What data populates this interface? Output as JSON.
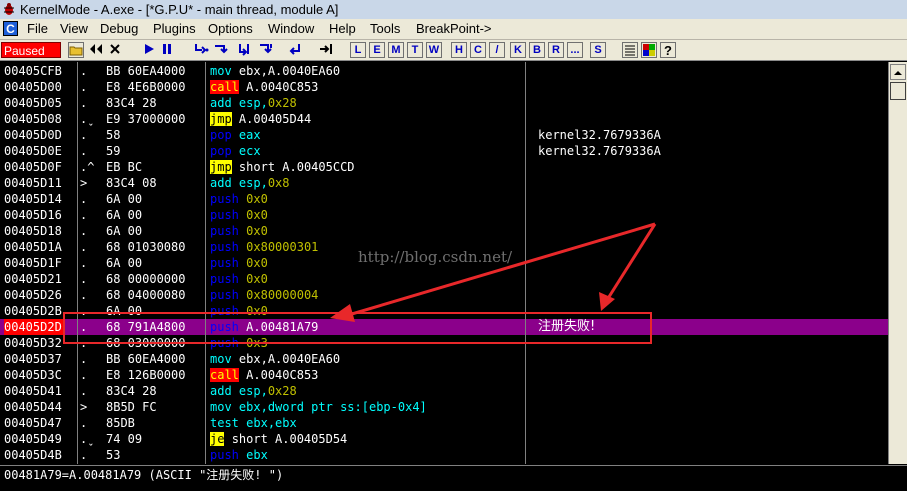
{
  "window": {
    "title": "KernelMode - A.exe - [*G.P.U* - main thread, module A]"
  },
  "menubar": {
    "system_label": "C",
    "items": [
      "File",
      "View",
      "Debug",
      "Plugins",
      "Options",
      "Window",
      "Help",
      "Tools",
      "BreakPoint->"
    ]
  },
  "toolbar": {
    "status": "Paused",
    "letters": [
      "L",
      "E",
      "M",
      "T",
      "W",
      "H",
      "C",
      "/",
      "K",
      "B",
      "R",
      "...",
      "S"
    ]
  },
  "disasm": {
    "rows": [
      {
        "addr": "00405CFB",
        "mark": ".",
        "hex": "BB 60EA4000",
        "op": "mov",
        "op_style": "normal",
        "args": "ebx,A.0040EA60",
        "args_style": "white",
        "comment": ""
      },
      {
        "addr": "00405D00",
        "mark": ".",
        "hex": "E8 4E6B0000",
        "op": "call",
        "op_style": "call",
        "args": "A.0040C853",
        "args_style": "white",
        "comment": ""
      },
      {
        "addr": "00405D05",
        "mark": ".",
        "hex": "83C4 28",
        "op": "add",
        "op_style": "normal",
        "args": "esp,0x28",
        "args_style": "mixed",
        "comment": ""
      },
      {
        "addr": "00405D08",
        "mark": ".ˬ",
        "hex": "E9 37000000",
        "op": "jmp",
        "op_style": "jmp",
        "args": "A.00405D44",
        "args_style": "white",
        "comment": ""
      },
      {
        "addr": "00405D0D",
        "mark": ".",
        "hex": "58",
        "op": "pop",
        "op_style": "pop",
        "args": "eax",
        "args_style": "normal",
        "comment": "kernel32.7679336A"
      },
      {
        "addr": "00405D0E",
        "mark": ".",
        "hex": "59",
        "op": "pop",
        "op_style": "pop",
        "args": "ecx",
        "args_style": "normal",
        "comment": "kernel32.7679336A"
      },
      {
        "addr": "00405D0F",
        "mark": ".^",
        "hex": "EB BC",
        "op": "jmp",
        "op_style": "jmp",
        "args": "short A.00405CCD",
        "args_style": "white",
        "comment": ""
      },
      {
        "addr": "00405D11",
        "mark": ">",
        "hex": "83C4 08",
        "op": "add",
        "op_style": "normal",
        "args": "esp,0x8",
        "args_style": "mixed",
        "comment": ""
      },
      {
        "addr": "00405D14",
        "mark": ".",
        "hex": "6A 00",
        "op": "push",
        "op_style": "push",
        "args": "0x0",
        "args_style": "olive",
        "comment": ""
      },
      {
        "addr": "00405D16",
        "mark": ".",
        "hex": "6A 00",
        "op": "push",
        "op_style": "push",
        "args": "0x0",
        "args_style": "olive",
        "comment": ""
      },
      {
        "addr": "00405D18",
        "mark": ".",
        "hex": "6A 00",
        "op": "push",
        "op_style": "push",
        "args": "0x0",
        "args_style": "olive",
        "comment": ""
      },
      {
        "addr": "00405D1A",
        "mark": ".",
        "hex": "68 01030080",
        "op": "push",
        "op_style": "push",
        "args": "0x80000301",
        "args_style": "olive",
        "comment": ""
      },
      {
        "addr": "00405D1F",
        "mark": ".",
        "hex": "6A 00",
        "op": "push",
        "op_style": "push",
        "args": "0x0",
        "args_style": "olive",
        "comment": ""
      },
      {
        "addr": "00405D21",
        "mark": ".",
        "hex": "68 00000000",
        "op": "push",
        "op_style": "push",
        "args": "0x0",
        "args_style": "olive",
        "comment": ""
      },
      {
        "addr": "00405D26",
        "mark": ".",
        "hex": "68 04000080",
        "op": "push",
        "op_style": "push",
        "args": "0x80000004",
        "args_style": "olive",
        "comment": ""
      },
      {
        "addr": "00405D2B",
        "mark": ".",
        "hex": "6A 00",
        "op": "push",
        "op_style": "push",
        "args": "0x0",
        "args_style": "olive",
        "comment": ""
      },
      {
        "addr": "00405D2D",
        "mark": ".",
        "hex": "68 791A4800",
        "op": "push",
        "op_style": "push",
        "args": "A.00481A79",
        "args_style": "white",
        "comment": "注册失败!",
        "selected": true
      },
      {
        "addr": "00405D32",
        "mark": ".",
        "hex": "68 03000000",
        "op": "push",
        "op_style": "push",
        "args": "0x3",
        "args_style": "olive",
        "comment": ""
      },
      {
        "addr": "00405D37",
        "mark": ".",
        "hex": "BB 60EA4000",
        "op": "mov",
        "op_style": "normal",
        "args": "ebx,A.0040EA60",
        "args_style": "white",
        "comment": ""
      },
      {
        "addr": "00405D3C",
        "mark": ".",
        "hex": "E8 126B0000",
        "op": "call",
        "op_style": "call",
        "args": "A.0040C853",
        "args_style": "white",
        "comment": ""
      },
      {
        "addr": "00405D41",
        "mark": ".",
        "hex": "83C4 28",
        "op": "add",
        "op_style": "normal",
        "args": "esp,0x28",
        "args_style": "mixed",
        "comment": ""
      },
      {
        "addr": "00405D44",
        "mark": ">",
        "hex": "8B5D FC",
        "op": "mov",
        "op_style": "normal",
        "args": "ebx,dword ptr ss:[ebp-0x4]",
        "args_style": "normal",
        "comment": ""
      },
      {
        "addr": "00405D47",
        "mark": ".",
        "hex": "85DB",
        "op": "test",
        "op_style": "normal",
        "args": "ebx,ebx",
        "args_style": "normal",
        "comment": ""
      },
      {
        "addr": "00405D49",
        "mark": ".ˬ",
        "hex": "74 09",
        "op": "je",
        "op_style": "jmp",
        "args": "short A.00405D54",
        "args_style": "white",
        "comment": ""
      },
      {
        "addr": "00405D4B",
        "mark": ".",
        "hex": "53",
        "op": "push",
        "op_style": "push",
        "args": "ebx",
        "args_style": "normal",
        "comment": ""
      }
    ]
  },
  "info": {
    "text": "00481A79=A.00481A79 (ASCII \"注册失败! \")"
  },
  "watermark": "http://blog.csdn.net/"
}
